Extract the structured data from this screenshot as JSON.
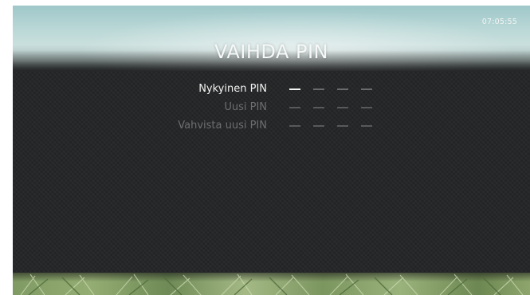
{
  "screen": {
    "clock": "07:05:55",
    "title": "VAIHDA PIN"
  },
  "pin_form": {
    "rows": [
      {
        "label": "Nykyinen PIN",
        "digits_entered": 0,
        "digit_slots": 4,
        "active": true
      },
      {
        "label": "Uusi PIN",
        "digits_entered": 0,
        "digit_slots": 4,
        "active": false
      },
      {
        "label": "Vahvista uusi PIN",
        "digits_entered": 0,
        "digit_slots": 4,
        "active": false
      }
    ]
  },
  "colors": {
    "active_text": "#f2f2f2",
    "inactive_text": "#6c6e70",
    "panel": "#222324"
  }
}
